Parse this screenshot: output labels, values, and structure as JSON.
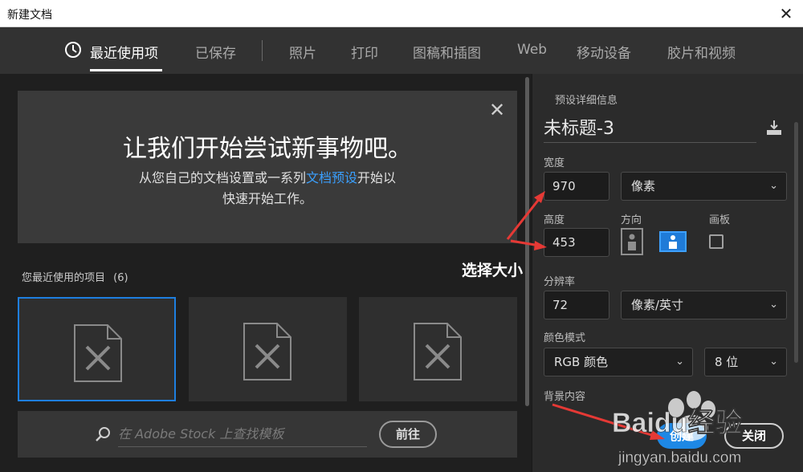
{
  "window": {
    "title": "新建文档"
  },
  "tabs": [
    {
      "label": "最近使用项",
      "active": true
    },
    {
      "label": "已保存"
    },
    {
      "label": "照片"
    },
    {
      "label": "打印"
    },
    {
      "label": "图稿和插图"
    },
    {
      "label": "Web"
    },
    {
      "label": "移动设备"
    },
    {
      "label": "胶片和视频"
    }
  ],
  "welcome": {
    "heading": "让我们开始尝试新事物吧。",
    "line1_pre": "从您自己的文档设置或一系列",
    "line1_link": "文档预设",
    "line1_post": "开始以",
    "line2": "快速开始工作。"
  },
  "recent": {
    "label": "您最近使用的项目",
    "count": "(6)"
  },
  "stock": {
    "placeholder": "在 Adobe Stock 上查找模板",
    "go_label": "前往"
  },
  "preset": {
    "section_label": "预设详细信息",
    "doc_name": "未标题-3",
    "width_label": "宽度",
    "width_value": "970",
    "width_unit": "像素",
    "height_label": "高度",
    "height_value": "453",
    "orientation_label": "方向",
    "artboard_label": "画板",
    "resolution_label": "分辨率",
    "resolution_value": "72",
    "resolution_unit": "像素/英寸",
    "color_mode_label": "颜色模式",
    "color_mode": "RGB 颜色",
    "bit_depth": "8 位",
    "background_label": "背景内容"
  },
  "buttons": {
    "create": "创建",
    "close": "关闭"
  },
  "annotation": {
    "text": "选择大小"
  },
  "watermark": {
    "brand": "Baidu经验",
    "url": "jingyan.baidu.com"
  },
  "colors": {
    "accent": "#1e88e5",
    "arrow": "#e53935",
    "link": "#3aa0ff"
  },
  "icons": [
    "clock-icon",
    "close-icon",
    "document-icon",
    "search-icon",
    "save-preset-icon",
    "portrait-icon",
    "landscape-icon",
    "chevron-down-icon"
  ]
}
